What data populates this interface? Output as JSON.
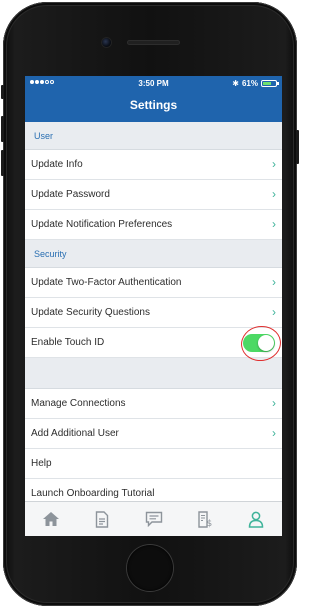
{
  "status_bar": {
    "time": "3:50 PM",
    "battery_percent": "61%",
    "battery_level": 0.61,
    "signal_bars": 3
  },
  "header": {
    "title": "Settings"
  },
  "sections": {
    "user": {
      "title": "User",
      "items": [
        "Update Info",
        "Update Password",
        "Update Notification Preferences"
      ]
    },
    "security": {
      "title": "Security",
      "items": [
        "Update Two-Factor Authentication",
        "Update Security Questions"
      ],
      "touch_id": {
        "label": "Enable Touch ID",
        "enabled": true
      }
    },
    "other": {
      "items": [
        "Manage Connections",
        "Add Additional User",
        "Help",
        "Launch Onboarding Tutorial"
      ]
    }
  },
  "tabbar": {
    "icons": [
      "home-icon",
      "document-icon",
      "message-icon",
      "bill-icon",
      "profile-icon"
    ],
    "active": "profile-icon"
  },
  "colors": {
    "primary": "#1f64ad",
    "accent": "#3fb39a",
    "toggle_on": "#4cd964",
    "annotation": "#e03030"
  }
}
